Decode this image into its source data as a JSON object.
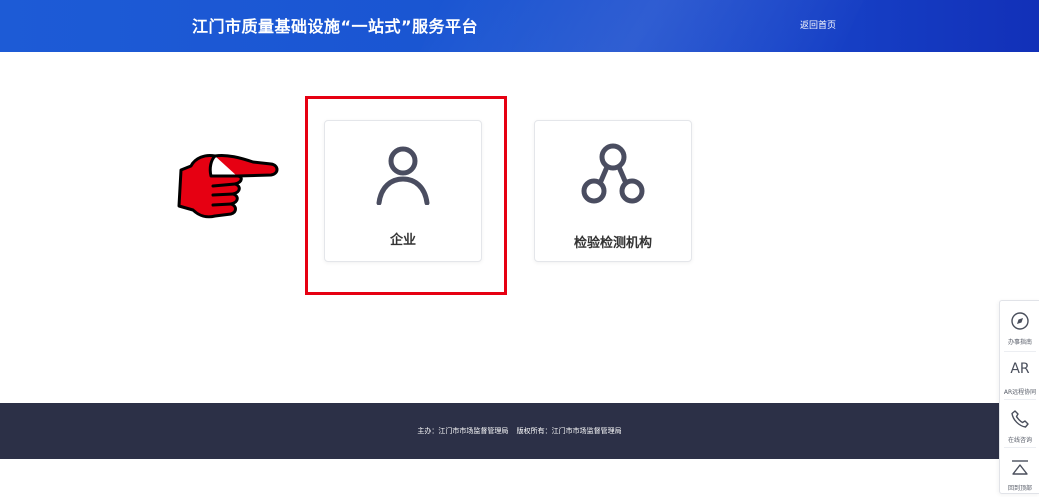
{
  "header": {
    "title": "江门市质量基础设施“一站式”服务平台",
    "home_link": "返回首页"
  },
  "cards": [
    {
      "label": "企业",
      "icon": "person-icon",
      "highlighted": true
    },
    {
      "label": "检验检测机构",
      "icon": "network-icon",
      "highlighted": false
    }
  ],
  "annotation": {
    "pointer_icon": "pointing-hand-icon",
    "highlight_color": "#e60012"
  },
  "footer": {
    "sponsor": "主办：江门市市场监督管理局",
    "copyright": "版权所有：江门市市场监督管理局"
  },
  "side_toolbar": [
    {
      "label": "办事指南",
      "icon": "compass-icon"
    },
    {
      "label": "AR远程协同",
      "icon": "ar-icon",
      "icon_text": "AR"
    },
    {
      "label": "在线咨询",
      "icon": "phone-icon"
    },
    {
      "label": "回到顶部",
      "icon": "back-to-top-icon"
    }
  ],
  "colors": {
    "header_bg": "#1a55d2",
    "footer_bg": "#2c3047",
    "icon_color": "#4a4d60"
  }
}
